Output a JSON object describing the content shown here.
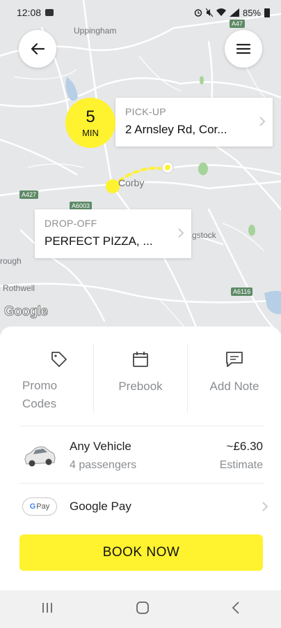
{
  "status_bar": {
    "time": "12:08",
    "battery": "85%"
  },
  "map": {
    "places": [
      "Uppingham",
      "Corby",
      "gstock",
      "rough",
      "Rothwell"
    ],
    "roads": [
      "A47",
      "A427",
      "A6003",
      "A6116"
    ],
    "attribution": "Google"
  },
  "eta": {
    "value": "5",
    "unit": "MIN"
  },
  "pickup": {
    "kicker": "PICK-UP",
    "address": "2 Arnsley Rd, Cor..."
  },
  "dropoff": {
    "kicker": "DROP-OFF",
    "address": "PERFECT PIZZA, ..."
  },
  "actions": {
    "promo_line1": "Promo",
    "promo_line2": "Codes",
    "prebook": "Prebook",
    "add_note": "Add Note"
  },
  "vehicle": {
    "name": "Any Vehicle",
    "passengers": "4 passengers",
    "price": "~£6.30",
    "price_note": "Estimate"
  },
  "payment": {
    "badge": "Pay",
    "badge_g": "G",
    "name": "Google Pay"
  },
  "book_button": "BOOK NOW",
  "colors": {
    "accent": "#fff22f",
    "route": "#fff22f"
  }
}
